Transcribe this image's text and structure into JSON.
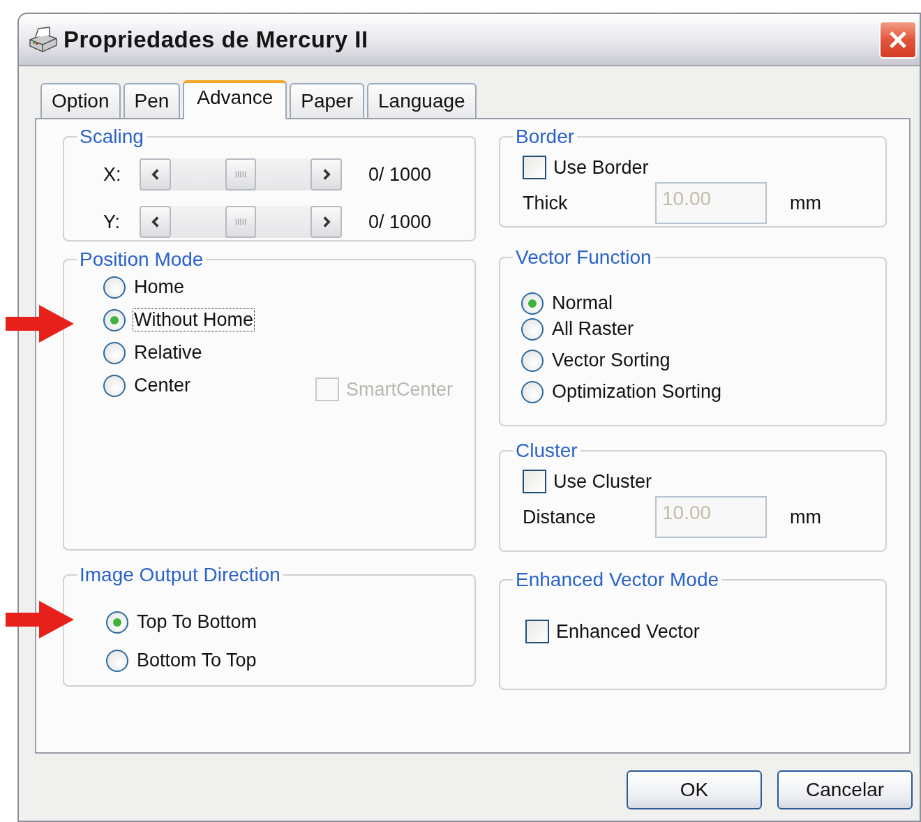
{
  "window": {
    "title": "Propriedades de Mercury II"
  },
  "tabs": [
    {
      "label": "Option",
      "selected": false
    },
    {
      "label": "Pen",
      "selected": false
    },
    {
      "label": "Advance",
      "selected": true
    },
    {
      "label": "Paper",
      "selected": false
    },
    {
      "label": "Language",
      "selected": false
    }
  ],
  "scaling": {
    "title": "Scaling",
    "rows": [
      {
        "label": "X:",
        "level": 0.5,
        "reading": "0/ 1000"
      },
      {
        "label": "Y:",
        "level": 0.5,
        "reading": "0/ 1000"
      }
    ]
  },
  "position_mode": {
    "title": "Position Mode",
    "options": [
      {
        "label": "Home",
        "selected": false,
        "focused": false
      },
      {
        "label": "Without Home",
        "selected": true,
        "focused": true
      },
      {
        "label": "Relative",
        "selected": false,
        "focused": false
      },
      {
        "label": "Center",
        "selected": false,
        "focused": false
      }
    ],
    "smart_center": {
      "label": "SmartCenter",
      "checked": false,
      "disabled": true
    }
  },
  "image_output_direction": {
    "title": "Image Output Direction",
    "options": [
      {
        "label": "Top To Bottom",
        "selected": true
      },
      {
        "label": "Bottom To Top",
        "selected": false
      }
    ]
  },
  "border": {
    "title": "Border",
    "checkbox": {
      "label": "Use Border",
      "checked": false
    },
    "field_label": "Thick",
    "value": "10.00",
    "disabled": true,
    "unit": "mm"
  },
  "vector_function": {
    "title": "Vector Function",
    "options": [
      {
        "label": "Normal",
        "selected": true
      },
      {
        "label": "All Raster",
        "selected": false
      },
      {
        "label": "Vector Sorting",
        "selected": false
      },
      {
        "label": "Optimization Sorting",
        "selected": false
      }
    ]
  },
  "cluster": {
    "title": "Cluster",
    "checkbox": {
      "label": "Use Cluster",
      "checked": false
    },
    "field_label": "Distance",
    "value": "10.00",
    "disabled": true,
    "unit": "mm"
  },
  "enhanced_vector_mode": {
    "title": "Enhanced Vector Mode",
    "checkbox": {
      "label": "Enhanced Vector",
      "checked": false
    }
  },
  "buttons": [
    {
      "label": "OK"
    },
    {
      "label": "Cancelar"
    }
  ]
}
